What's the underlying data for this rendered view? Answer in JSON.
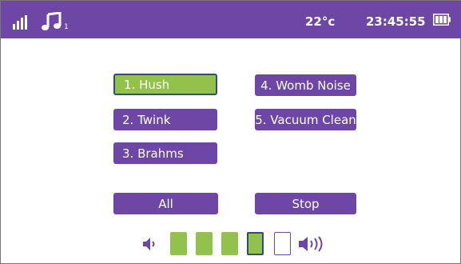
{
  "status_bar": {
    "temperature": "22°c",
    "time": "23:45:55",
    "note_subscript": "1",
    "icons": [
      "signal-icon",
      "music-note-icon",
      "battery-icon"
    ]
  },
  "tracks": [
    {
      "label": "1. Hush",
      "selected": true
    },
    {
      "label": "2. Twink",
      "selected": false
    },
    {
      "label": "3. Brahms",
      "selected": false
    },
    {
      "label": "4. Womb Noise",
      "selected": false
    },
    {
      "label": "5. Vacuum Clean",
      "selected": false
    }
  ],
  "controls": {
    "all_label": "All",
    "stop_label": "Stop"
  },
  "volume": {
    "level": 4,
    "max": 5,
    "icons": [
      "volume-down-icon",
      "volume-up-icon"
    ]
  },
  "colors": {
    "accent": "#6e47a6",
    "selected_fill": "#92c24c",
    "selected_border": "#2c4f7a"
  }
}
